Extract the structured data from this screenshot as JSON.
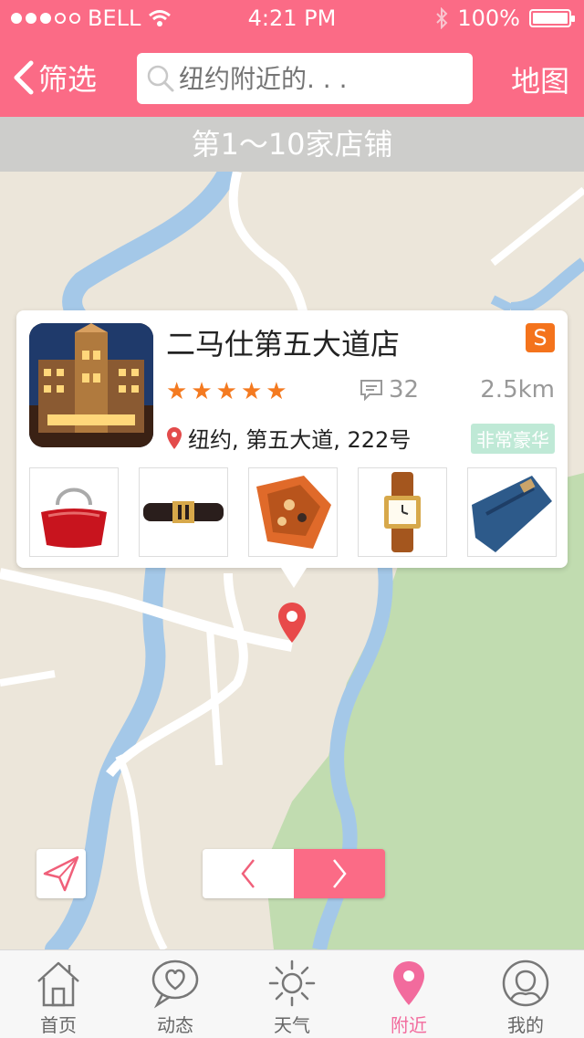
{
  "status_bar": {
    "carrier": "BELL",
    "time": "4:21 PM",
    "battery": "100%"
  },
  "nav": {
    "back_label": "筛选",
    "search_placeholder": "纽约附近的. . .",
    "map_label": "地图"
  },
  "result_banner": "第1～10家店铺",
  "store": {
    "name": "二马仕第五大道店",
    "badge": "S",
    "rating": 5,
    "comment_count": "32",
    "distance": "2.5km",
    "address": "纽约, 第五大道, 222号",
    "tag": "非常豪华",
    "products": [
      "handbag",
      "belt",
      "scarf",
      "watch",
      "jeans"
    ]
  },
  "tabbar": {
    "tabs": [
      {
        "label": "首页",
        "icon": "home-icon"
      },
      {
        "label": "动态",
        "icon": "heart-bubble-icon"
      },
      {
        "label": "天气",
        "icon": "sun-icon"
      },
      {
        "label": "附近",
        "icon": "location-pin-icon",
        "active": true
      },
      {
        "label": "我的",
        "icon": "user-icon"
      }
    ]
  },
  "colors": {
    "accent": "#fb6b86",
    "star": "#f47a20",
    "badge": "#f4731c",
    "tag_bg": "#bfe9d6",
    "active_tab": "#f26b9d"
  }
}
